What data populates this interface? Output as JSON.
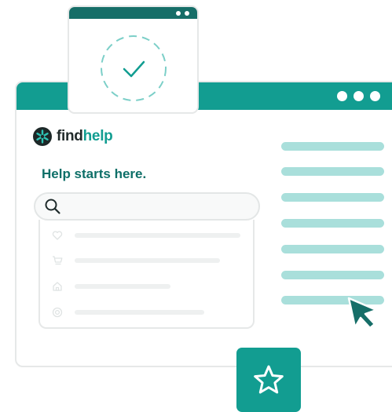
{
  "brand": {
    "name_part1": "find",
    "name_part2": "help",
    "primary_color": "#129d91",
    "dark_color": "#166e68",
    "light_color": "#a9dfdb"
  },
  "tagline": "Help starts here.",
  "search": {
    "icon": "search-icon",
    "placeholder": ""
  },
  "dropdown_rows": [
    {
      "icon": "heart-icon"
    },
    {
      "icon": "cart-icon"
    },
    {
      "icon": "home-icon"
    },
    {
      "icon": "target-icon"
    }
  ],
  "content_lines": 7,
  "mini_window_icon": "check-circle-icon",
  "favorite_icon": "star-icon",
  "cursor_icon": "pointer-cursor-icon"
}
